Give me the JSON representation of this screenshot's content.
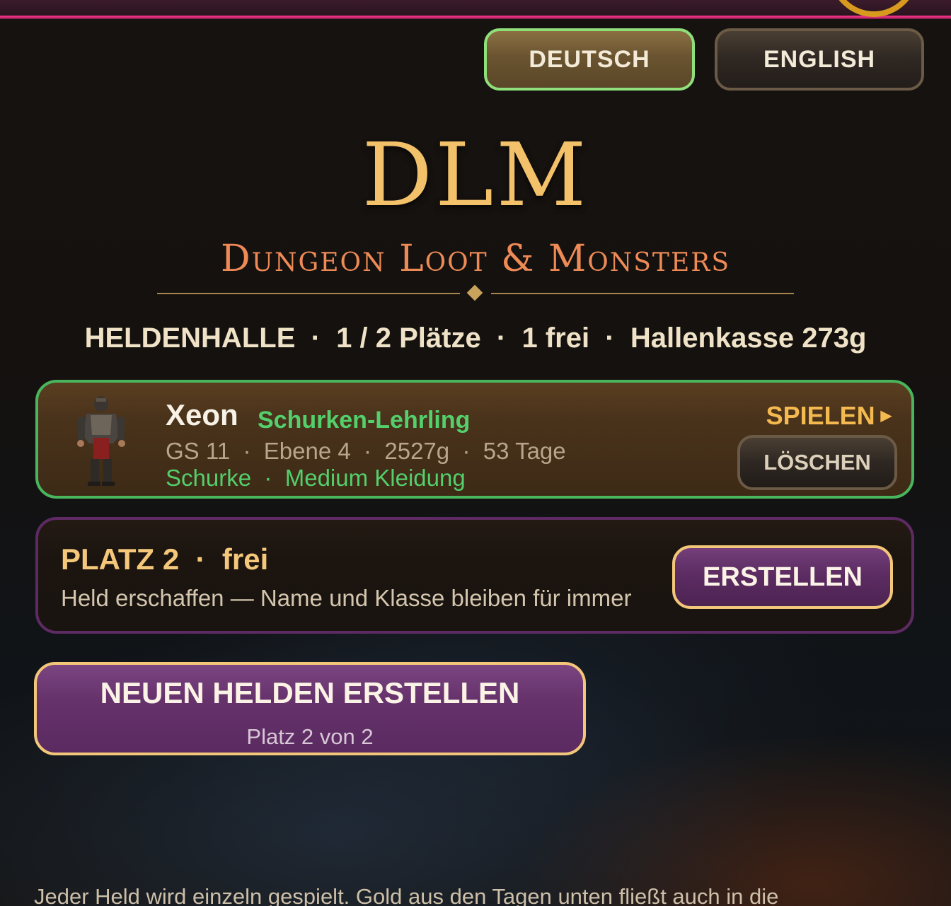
{
  "language": {
    "german_label": "DEUTSCH",
    "english_label": "ENGLISH",
    "active": "DEUTSCH",
    "active_border_color": "#8fe07a"
  },
  "branding": {
    "logo": "DLM",
    "subtitle": "Dungeon Loot & Monsters",
    "logo_color": "#f2c16a",
    "subtitle_color": "#ee8a56"
  },
  "hall": {
    "summary": "HELDENHALLE  ·  1 / 2 Plätze  ·  1 frei  ·  Hallenkasse 273g"
  },
  "hero_slot": {
    "name": "Xeon",
    "title": "Schurken-Lehrling",
    "stats": "GS 11  ·  Ebene 4  ·  2527g  ·  53 Tage",
    "class_line": "Schurke  ·  Medium Kleidung",
    "play_label": "SPIELEN",
    "play_icon": "play-triangle-icon",
    "delete_label": "LÖSCHEN",
    "avatar_icon": "rogue-character-sprite",
    "border_color": "#49b55c"
  },
  "empty_slot": {
    "title": "PLATZ 2  ·  frei",
    "description": "Held erschaffen — Name und Klasse bleiben für immer",
    "create_label": "ERSTELLEN",
    "border_color": "#5e2a63"
  },
  "new_hero": {
    "label": "NEUEN HELDEN ERSTELLEN",
    "sublabel": "Platz 2 von 2",
    "border_color": "#f3c77a"
  },
  "footer": {
    "text": "Jeder Held wird einzeln gespielt. Gold aus den Tagen unten fließt auch in die"
  },
  "accent_colors": {
    "top_bar": "#e4307e",
    "gold_ring": "#d79a1f"
  }
}
